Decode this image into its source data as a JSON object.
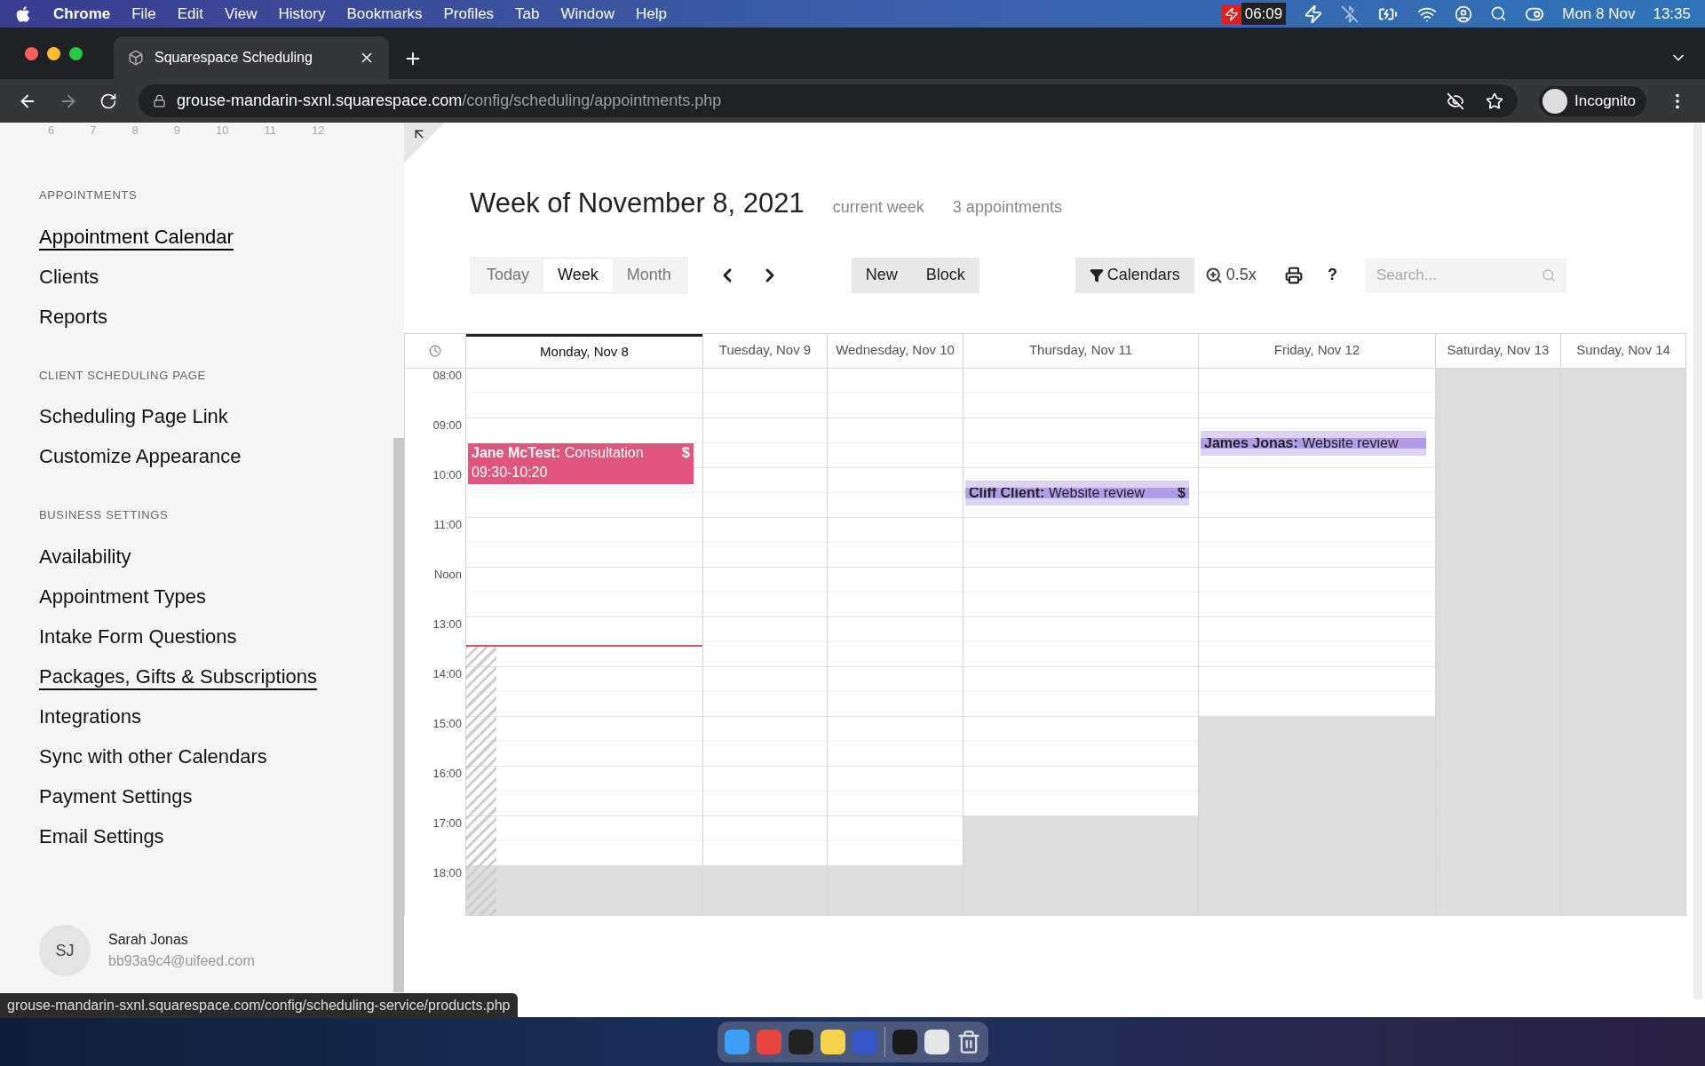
{
  "menu_bar": {
    "app": "Chrome",
    "menus": [
      "File",
      "Edit",
      "View",
      "History",
      "Bookmarks",
      "Profiles",
      "Tab",
      "Window",
      "Help"
    ],
    "timer": "06:09",
    "date": "Mon 8 Nov",
    "time": "13:35"
  },
  "browser": {
    "tab_title": "Squarespace Scheduling",
    "url_host": "grouse-mandarin-sxnl.squarespace.com",
    "url_path": "/config/scheduling/appointments.php",
    "profile": "Incognito",
    "status_url": "grouse-mandarin-sxnl.squarespace.com/config/scheduling-service/products.php"
  },
  "sidebar": {
    "mini_calendar_days": [
      "6",
      "7",
      "8",
      "9",
      "10",
      "11",
      "12"
    ],
    "sections": [
      {
        "title": "APPOINTMENTS",
        "items": [
          {
            "label": "Appointment Calendar",
            "selected": true,
            "hovered": false
          },
          {
            "label": "Clients",
            "selected": false,
            "hovered": false
          },
          {
            "label": "Reports",
            "selected": false,
            "hovered": false
          }
        ]
      },
      {
        "title": "CLIENT SCHEDULING PAGE",
        "items": [
          {
            "label": "Scheduling Page Link",
            "selected": false,
            "hovered": false
          },
          {
            "label": "Customize Appearance",
            "selected": false,
            "hovered": false
          }
        ]
      },
      {
        "title": "BUSINESS SETTINGS",
        "items": [
          {
            "label": "Availability",
            "selected": false,
            "hovered": false
          },
          {
            "label": "Appointment Types",
            "selected": false,
            "hovered": false
          },
          {
            "label": "Intake Form Questions",
            "selected": false,
            "hovered": false
          },
          {
            "label": "Packages, Gifts & Subscriptions",
            "selected": false,
            "hovered": true
          },
          {
            "label": "Integrations",
            "selected": false,
            "hovered": false
          },
          {
            "label": "Sync with other Calendars",
            "selected": false,
            "hovered": false
          },
          {
            "label": "Payment Settings",
            "selected": false,
            "hovered": false
          },
          {
            "label": "Email Settings",
            "selected": false,
            "hovered": false
          }
        ]
      }
    ],
    "user": {
      "initials": "SJ",
      "name": "Sarah Jonas",
      "email": "bb93a9c4@uifeed.com"
    }
  },
  "calendar": {
    "title": "Week of November 8, 2021",
    "current_label": "current week",
    "count": "3 appointments",
    "views": [
      {
        "label": "Today",
        "selected": false
      },
      {
        "label": "Week",
        "selected": true
      },
      {
        "label": "Month",
        "selected": false
      }
    ],
    "actions": [
      "New",
      "Block"
    ],
    "calendars_button": "Calendars",
    "zoom": "0.5x",
    "help": "?",
    "search": {
      "placeholder": "Search..."
    },
    "hours": [
      "08:00",
      "09:00",
      "10:00",
      "11:00",
      "Noon",
      "13:00",
      "14:00",
      "15:00",
      "16:00",
      "17:00",
      "18:00"
    ],
    "days": [
      {
        "label": "Monday, Nov 8",
        "selected": true,
        "events": [
          {
            "client": "Jane McTest:",
            "type": "Consultation",
            "time": "09:30-10:20",
            "price_mark": "$",
            "kind": "solid",
            "color": "#df557b"
          }
        ]
      },
      {
        "label": "Tuesday, Nov 9",
        "selected": false
      },
      {
        "label": "Wednesday, Nov 10",
        "selected": false
      },
      {
        "label": "Thursday, Nov 11",
        "selected": false,
        "events": [
          {
            "client": "Cliff Client:",
            "type": "Website review",
            "price_mark": "$",
            "kind": "hatched",
            "color": "#b29ce9"
          }
        ]
      },
      {
        "label": "Friday, Nov 12",
        "selected": false,
        "events": [
          {
            "client": "James Jonas:",
            "type": "Website review",
            "kind": "hatched",
            "color": "#b29ce9"
          }
        ]
      },
      {
        "label": "Saturday, Nov 13",
        "selected": false
      },
      {
        "label": "Sunday, Nov 14",
        "selected": false
      }
    ]
  }
}
